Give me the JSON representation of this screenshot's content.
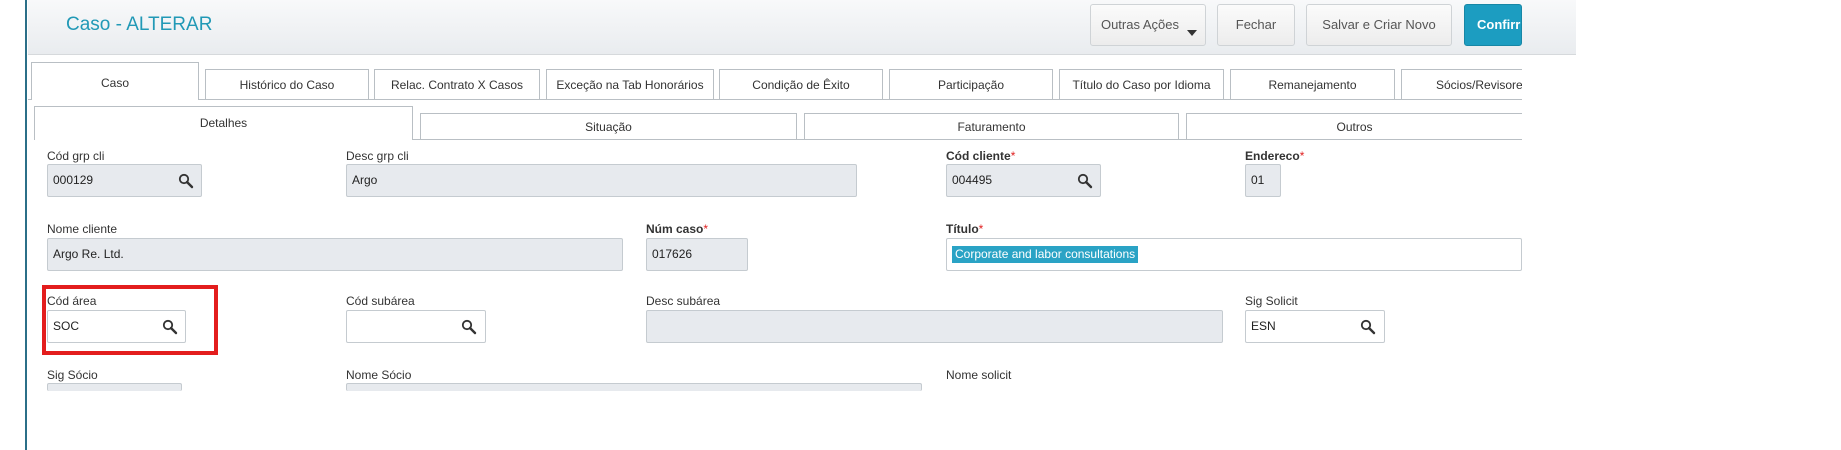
{
  "header": {
    "title": "Caso - ALTERAR",
    "buttons": {
      "outras_acoes": "Outras Ações",
      "fechar": "Fechar",
      "salvar_criar": "Salvar e Criar Novo",
      "confirmar": "Confirr"
    }
  },
  "tabs_main": [
    "Caso",
    "Histórico do Caso",
    "Relac. Contrato X Casos",
    "Exceção na Tab Honorários",
    "Condição de Êxito",
    "Participação",
    "Título do Caso por Idioma",
    "Remanejamento",
    "Sócios/Revisore"
  ],
  "tabs_sub": [
    "Detalhes",
    "Situação",
    "Faturamento",
    "Outros"
  ],
  "form": {
    "cod_grp_cli": {
      "label": "Cód grp cli",
      "value": "000129"
    },
    "desc_grp_cli": {
      "label": "Desc grp cli",
      "value": "Argo"
    },
    "cod_cliente": {
      "label": "Cód cliente",
      "value": "004495"
    },
    "endereco": {
      "label": "Endereco",
      "value": "01"
    },
    "nome_cliente": {
      "label": "Nome cliente",
      "value": "Argo Re. Ltd."
    },
    "num_caso": {
      "label": "Núm caso",
      "value": "017626"
    },
    "titulo": {
      "label": "Título",
      "value": "Corporate and labor consultations"
    },
    "cod_area": {
      "label": "Cód área",
      "value": "SOC"
    },
    "cod_subarea": {
      "label": "Cód subárea",
      "value": ""
    },
    "desc_subarea": {
      "label": "Desc subárea",
      "value": ""
    },
    "sig_solicit": {
      "label": "Sig Solicit",
      "value": "ESN"
    },
    "sig_socio": {
      "label": "Sig Sócio"
    },
    "nome_socio": {
      "label": "Nome Sócio"
    },
    "nome_solicit": {
      "label": "Nome solicit"
    }
  },
  "required_marker": "*",
  "colors": {
    "title": "#2199b6",
    "primary_button": "#1c9dc1",
    "selection": "#2aa3c5",
    "required_star": "#e02020",
    "highlight_box": "#e31d1d"
  }
}
